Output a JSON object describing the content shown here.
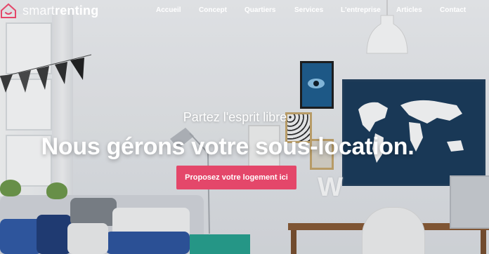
{
  "brand": {
    "logo_light": "smart",
    "logo_bold": "renting"
  },
  "nav": {
    "items": [
      {
        "label": "Accueil"
      },
      {
        "label": "Concept"
      },
      {
        "label": "Quartiers"
      },
      {
        "label": "Services"
      },
      {
        "label": "L'entreprise"
      },
      {
        "label": "Articles"
      },
      {
        "label": "Contact"
      }
    ]
  },
  "hero": {
    "tagline": "Partez l'esprit libre.",
    "headline": "Nous gérons votre sous-location.",
    "cta_label": "Proposez votre logement ici"
  },
  "colors": {
    "accent": "#e4476a",
    "text": "#ffffff"
  },
  "icons": {
    "logo": "house-icon"
  }
}
